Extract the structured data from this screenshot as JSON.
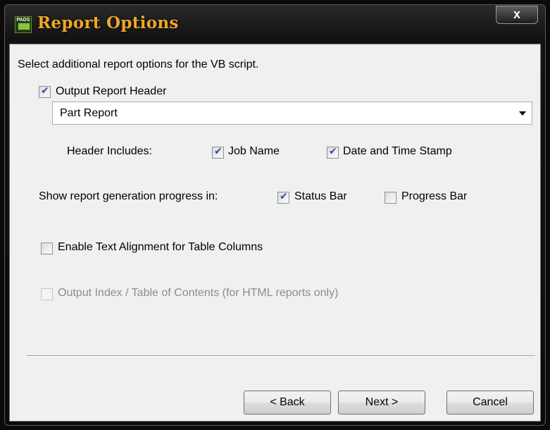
{
  "window": {
    "title": "Report Options",
    "app_icon_label": "PADS",
    "close_label": "x"
  },
  "prompt": "Select additional report options for the VB script.",
  "output_header": {
    "label": "Output Report Header",
    "checked": true,
    "combo_value": "Part Report"
  },
  "header_includes": {
    "label": "Header Includes:",
    "job_name": {
      "label": "Job Name",
      "checked": true
    },
    "date_time": {
      "label": "Date and Time Stamp",
      "checked": true
    }
  },
  "progress": {
    "label": "Show report generation progress in:",
    "status_bar": {
      "label": "Status Bar",
      "checked": true
    },
    "progress_bar": {
      "label": "Progress Bar",
      "checked": false
    }
  },
  "text_alignment": {
    "label": "Enable Text Alignment for Table Columns",
    "checked": false
  },
  "output_index": {
    "label": "Output Index / Table of Contents (for HTML reports only)",
    "checked": false,
    "enabled": false
  },
  "buttons": {
    "back": "< Back",
    "next": "Next >",
    "cancel": "Cancel"
  }
}
